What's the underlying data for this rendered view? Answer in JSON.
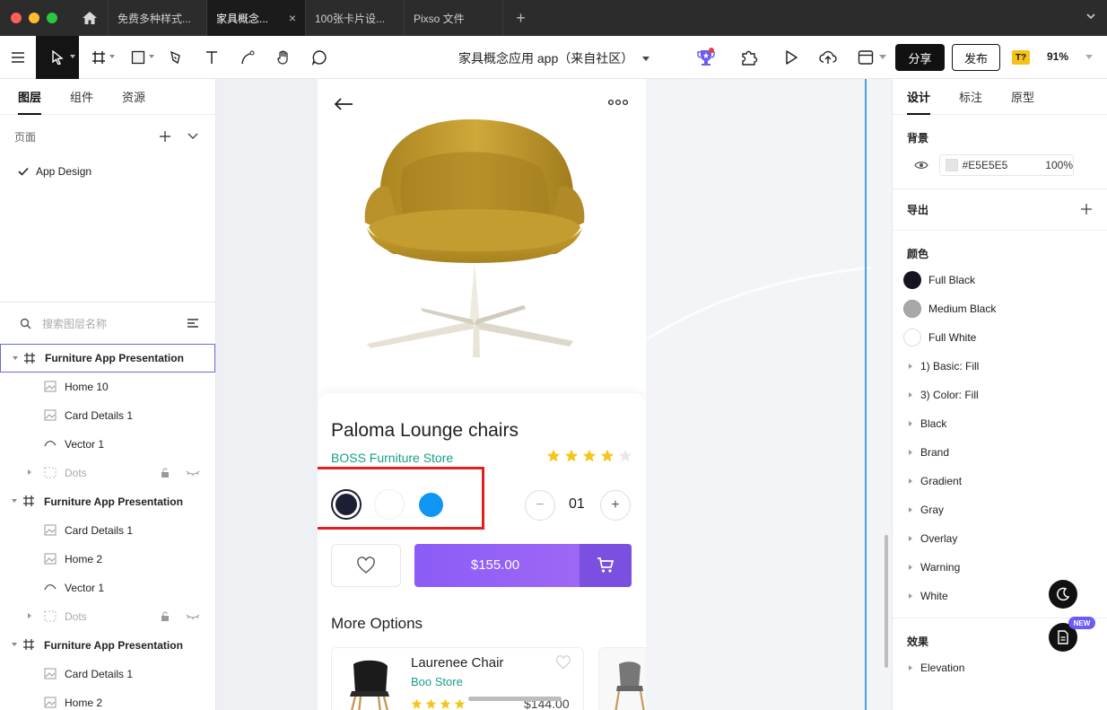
{
  "tabs": [
    {
      "label": "免费多种样式..."
    },
    {
      "label": "家具概念..."
    },
    {
      "label": "100张卡片设..."
    },
    {
      "label": "Pixso 文件"
    }
  ],
  "toolbar": {
    "doc_title": "家具概念应用 app（来自社区）",
    "share_label": "分享",
    "publish_label": "发布",
    "badge": "T?",
    "zoom": "91%"
  },
  "left_panel": {
    "tabs": [
      "图层",
      "组件",
      "资源"
    ],
    "pages_label": "页面",
    "page_item": "App Design",
    "search_placeholder": "搜索图层名称",
    "layers": [
      {
        "label": "Furniture App Presentation"
      },
      {
        "label": "Home 10"
      },
      {
        "label": "Card Details 1"
      },
      {
        "label": "Vector 1"
      },
      {
        "label": "Dots"
      },
      {
        "label": "Furniture App Presentation"
      },
      {
        "label": "Card Details 1"
      },
      {
        "label": "Home 2"
      },
      {
        "label": "Vector 1"
      },
      {
        "label": "Dots"
      },
      {
        "label": "Furniture App Presentation"
      },
      {
        "label": "Card Details 1"
      },
      {
        "label": "Home 2"
      }
    ]
  },
  "app": {
    "product_title": "Paloma Lounge chairs",
    "store": "BOSS Furniture Store",
    "rating": 4,
    "rating_max": 5,
    "swatch_colors": [
      "#1c1f33",
      "#ffffff",
      "#0f96f5"
    ],
    "quantity": "01",
    "qty_minus": "−",
    "qty_plus": "+",
    "price": "$155.00",
    "more_options": "More Options",
    "option": {
      "name": "Laurenee Chair",
      "store": "Boo Store",
      "price": "$144.00",
      "rating": 4
    }
  },
  "right_panel": {
    "tabs": [
      "设计",
      "标注",
      "原型"
    ],
    "background_label": "背景",
    "bg_hex": "#E5E5E5",
    "bg_opacity": "100%",
    "export_label": "导出",
    "colors_label": "颜色",
    "colors": [
      {
        "name": "Full Black",
        "hex": "#151522"
      },
      {
        "name": "Medium Black",
        "hex": "#a8a8a8"
      },
      {
        "name": "Full White",
        "hex": "#ffffff"
      }
    ],
    "styles": [
      "1) Basic: Fill",
      "3) Color: Fill",
      "Black",
      "Brand",
      "Gradient",
      "Gray",
      "Overlay",
      "Warning",
      "White"
    ],
    "effects_label": "效果",
    "effects": [
      "Elevation"
    ],
    "new_badge": "NEW"
  }
}
